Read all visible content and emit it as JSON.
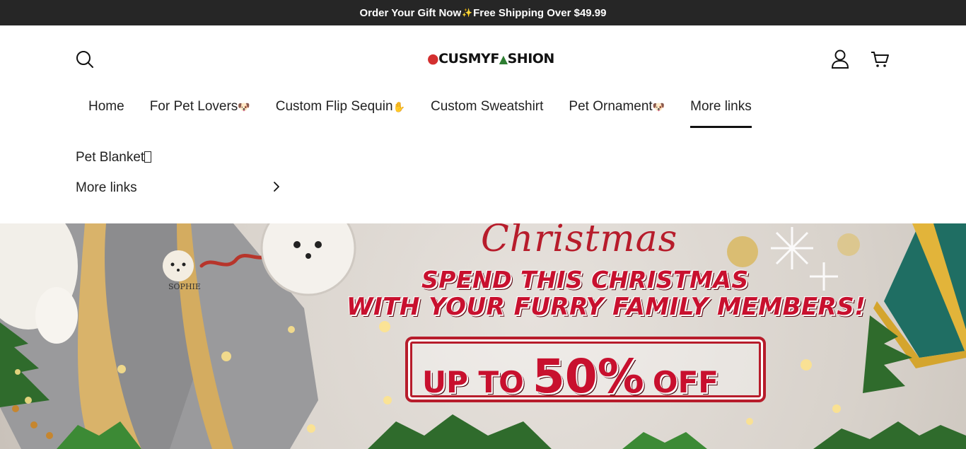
{
  "announcement": {
    "text_before": "Order Your Gift Now",
    "sparkle": "✨",
    "text_after": "Free Shipping Over $49.99"
  },
  "header": {
    "logo_text_left": "CUSMYF",
    "logo_text_right": "SHION",
    "search_icon": "search-icon",
    "account_icon": "user-icon",
    "cart_icon": "cart-icon"
  },
  "nav": {
    "items": [
      {
        "label": "Home",
        "emoji": ""
      },
      {
        "label": "For Pet Lovers",
        "emoji": "🐶"
      },
      {
        "label": "Custom Flip Sequin",
        "emoji": "✋"
      },
      {
        "label": "Custom Sweatshirt",
        "emoji": ""
      },
      {
        "label": "Pet Ornament",
        "emoji": "🐶"
      },
      {
        "label": "More links",
        "emoji": ""
      }
    ],
    "active": "More links"
  },
  "dropdown": {
    "items": [
      {
        "label": "Pet Blanket"
      },
      {
        "label": "More links"
      }
    ]
  },
  "banner": {
    "script_title": "Christmas",
    "line1": "SPEND THIS CHRISTMAS",
    "line2": "WITH YOUR FURRY FAMILY MEMBERS!",
    "offer_prefix": "UP TO",
    "offer_value": "50%",
    "offer_suffix": "OFF",
    "pet_name": "SOPHIE"
  },
  "colors": {
    "announcement_bg": "#262626",
    "accent_red": "#c8102e",
    "nav_underline": "#111111"
  }
}
